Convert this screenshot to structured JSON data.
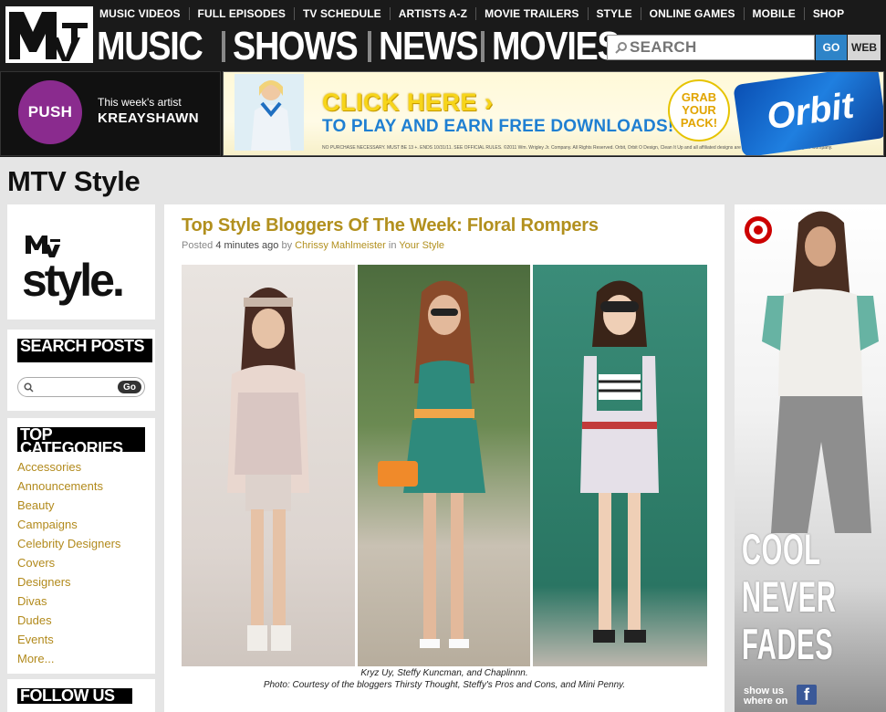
{
  "header": {
    "logo_text": "MTV",
    "top_nav": [
      "MUSIC VIDEOS",
      "FULL EPISODES",
      "TV SCHEDULE",
      "ARTISTS A-Z",
      "MOVIE TRAILERS",
      "STYLE",
      "ONLINE GAMES",
      "MOBILE",
      "SHOP"
    ],
    "big_nav": [
      "MUSIC",
      "SHOWS",
      "NEWS",
      "MOVIES"
    ],
    "search": {
      "placeholder": "SEARCH",
      "go_label": "GO",
      "web_label": "WEB"
    }
  },
  "push": {
    "badge": "PUSH",
    "line1": "This week's artist",
    "line2": "KREAYSHAWN"
  },
  "banner": {
    "headline": "CLICK HERE ›",
    "subline": "TO PLAY AND EARN FREE DOWNLOADS!",
    "fine_print": "NO PURCHASE NECESSARY. MUST BE 13 +. ENDS 10/31/11. SEE OFFICIAL RULES. ©2011 Wm. Wrigley Jr. Company. All Rights Reserved. Orbit, Orbit O Design, Clean It Up and all affiliated designs are trademarks of the Wm. Wrigley Jr. Company.",
    "grab_text": "GRAB YOUR PACK!",
    "product": "Orbit"
  },
  "page_title": "MTV Style",
  "sidebar": {
    "logo_word": "style.",
    "search_posts_heading": "SEARCH POSTS",
    "search_go": "Go",
    "top_categories_heading": "TOP CATEGORIES",
    "categories": [
      "Accessories",
      "Announcements",
      "Beauty",
      "Campaigns",
      "Celebrity Designers",
      "Covers",
      "Designers",
      "Divas",
      "Dudes",
      "Events",
      "More..."
    ],
    "follow_heading": "FOLLOW US"
  },
  "post": {
    "title": "Top Style Bloggers Of The Week: Floral Rompers",
    "meta_posted": "Posted",
    "meta_time": "4 minutes ago",
    "meta_by": "by",
    "meta_author": "Chrissy Mahlmeister",
    "meta_in": "in",
    "meta_category": "Your Style",
    "caption_line1": "Kryz Uy, Steffy Kuncman, and Chaplinnn.",
    "caption_line2": "Photo: Courtesy of the bloggers Thirsty Thought, Steffy's Pros and Cons, and Mini Penny."
  },
  "right_ad": {
    "slogan_line1": "COOL",
    "slogan_line2": "NEVER",
    "slogan_line3": "FADES",
    "show_us": "show us",
    "where_on": "where on"
  },
  "colors": {
    "header_bg": "#1a1a1a",
    "accent_gold": "#b2901e",
    "push_purple": "#8a2b8e",
    "go_blue": "#2e84c8"
  }
}
